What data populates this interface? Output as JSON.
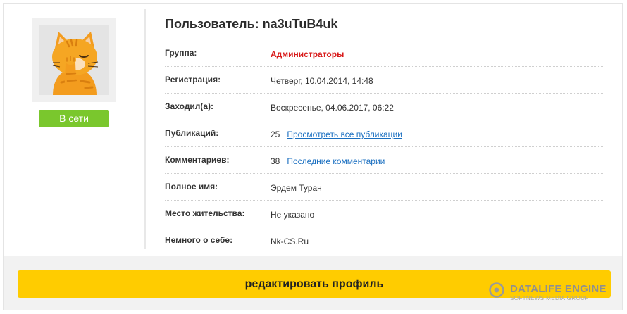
{
  "profile": {
    "title_prefix": "Пользователь:",
    "username": "na3uTuB4uk",
    "status": "В сети"
  },
  "rows": [
    {
      "label": "Группа:",
      "value": "Администраторы"
    },
    {
      "label": "Регистрация:",
      "value": "Четверг, 10.04.2014, 14:48"
    },
    {
      "label": "Заходил(а):",
      "value": "Воскресенье, 04.06.2017, 06:22"
    },
    {
      "label": "Публикаций:",
      "value": "25",
      "link": "Просмотреть все публикации"
    },
    {
      "label": "Комментариев:",
      "value": "38",
      "link": "Последние комментарии"
    },
    {
      "label": "Полное имя:",
      "value": "Эрдем Туран"
    },
    {
      "label": "Место жительства:",
      "value": "Не указано"
    },
    {
      "label": "Немного о себе:",
      "value": "Nk-CS.Ru"
    }
  ],
  "actions": {
    "edit_label": "редактировать профиль"
  },
  "watermark": {
    "title": "DATALIFE ENGINE",
    "subtitle": "SOFTNEWS MEDIA GROUP"
  },
  "colors": {
    "status_green": "#7ac72d",
    "button_yellow": "#ffcc00",
    "group_red": "#d81b1b",
    "link_blue": "#1a6fc0"
  }
}
